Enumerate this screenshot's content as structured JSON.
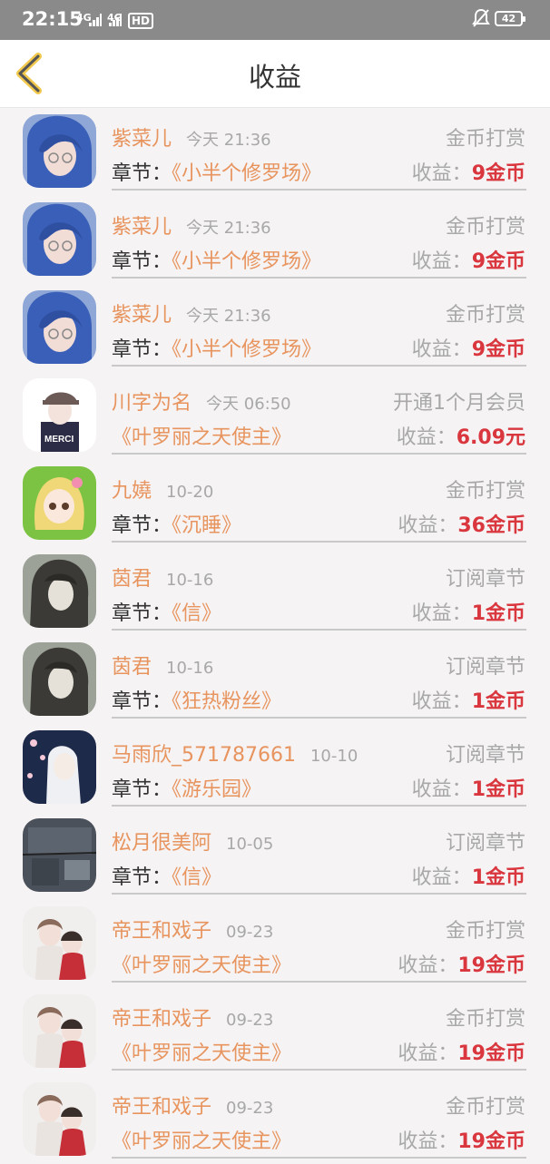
{
  "status_bar": {
    "time": "22:15",
    "signal1": "4G",
    "signal2": "4G",
    "hd": "HD",
    "battery": "42"
  },
  "header": {
    "title": "收益"
  },
  "labels": {
    "chapter_prefix": "章节：",
    "earn_prefix": "收益："
  },
  "colors": {
    "accent": "#e8945e",
    "amount": "#d9363e",
    "muted": "#a8a8a8"
  },
  "items": [
    {
      "name": "紫菜儿",
      "time": "今天 21:36",
      "type": "金币打赏",
      "chapter_label": "章节：",
      "book": "《小半个修罗场》",
      "earn_label": "收益：",
      "amount": "9金币",
      "avatar": "blue-hair-avatar"
    },
    {
      "name": "紫菜儿",
      "time": "今天 21:36",
      "type": "金币打赏",
      "chapter_label": "章节：",
      "book": "《小半个修罗场》",
      "earn_label": "收益：",
      "amount": "9金币",
      "avatar": "blue-hair-avatar"
    },
    {
      "name": "紫菜儿",
      "time": "今天 21:36",
      "type": "金币打赏",
      "chapter_label": "章节：",
      "book": "《小半个修罗场》",
      "earn_label": "收益：",
      "amount": "9金币",
      "avatar": "blue-hair-avatar"
    },
    {
      "name": "川字为名",
      "time": "今天 06:50",
      "type": "开通1个月会员",
      "chapter_label": "",
      "book": "《叶罗丽之天使主》",
      "earn_label": "收益：",
      "amount": "6.09元",
      "avatar": "merci-avatar"
    },
    {
      "name": "九嬈",
      "time": "10-20",
      "type": "金币打赏",
      "chapter_label": "章节：",
      "book": "《沉睡》",
      "earn_label": "收益：",
      "amount": "36金币",
      "avatar": "green-girl-avatar"
    },
    {
      "name": "茵君",
      "time": "10-16",
      "type": "订阅章节",
      "chapter_label": "章节：",
      "book": "《信》",
      "earn_label": "收益：",
      "amount": "1金币",
      "avatar": "dark-hair-avatar"
    },
    {
      "name": "茵君",
      "time": "10-16",
      "type": "订阅章节",
      "chapter_label": "章节：",
      "book": "《狂热粉丝》",
      "earn_label": "收益：",
      "amount": "1金币",
      "avatar": "dark-hair-avatar"
    },
    {
      "name": "马雨欣_571787661",
      "time": "10-10",
      "type": "订阅章节",
      "chapter_label": "章节：",
      "book": "《游乐园》",
      "earn_label": "收益：",
      "amount": "1金币",
      "avatar": "white-hair-avatar"
    },
    {
      "name": "松月很美阿",
      "time": "10-05",
      "type": "订阅章节",
      "chapter_label": "章节：",
      "book": "《信》",
      "earn_label": "收益：",
      "amount": "1金币",
      "avatar": "gray-scene-avatar"
    },
    {
      "name": "帝王和戏子",
      "time": "09-23",
      "type": "金币打赏",
      "chapter_label": "",
      "book": "《叶罗丽之天使主》",
      "earn_label": "收益：",
      "amount": "19金币",
      "avatar": "couple-avatar"
    },
    {
      "name": "帝王和戏子",
      "time": "09-23",
      "type": "金币打赏",
      "chapter_label": "",
      "book": "《叶罗丽之天使主》",
      "earn_label": "收益：",
      "amount": "19金币",
      "avatar": "couple-avatar"
    },
    {
      "name": "帝王和戏子",
      "time": "09-23",
      "type": "金币打赏",
      "chapter_label": "",
      "book": "《叶罗丽之天使主》",
      "earn_label": "收益：",
      "amount": "19金币",
      "avatar": "couple-avatar"
    }
  ]
}
